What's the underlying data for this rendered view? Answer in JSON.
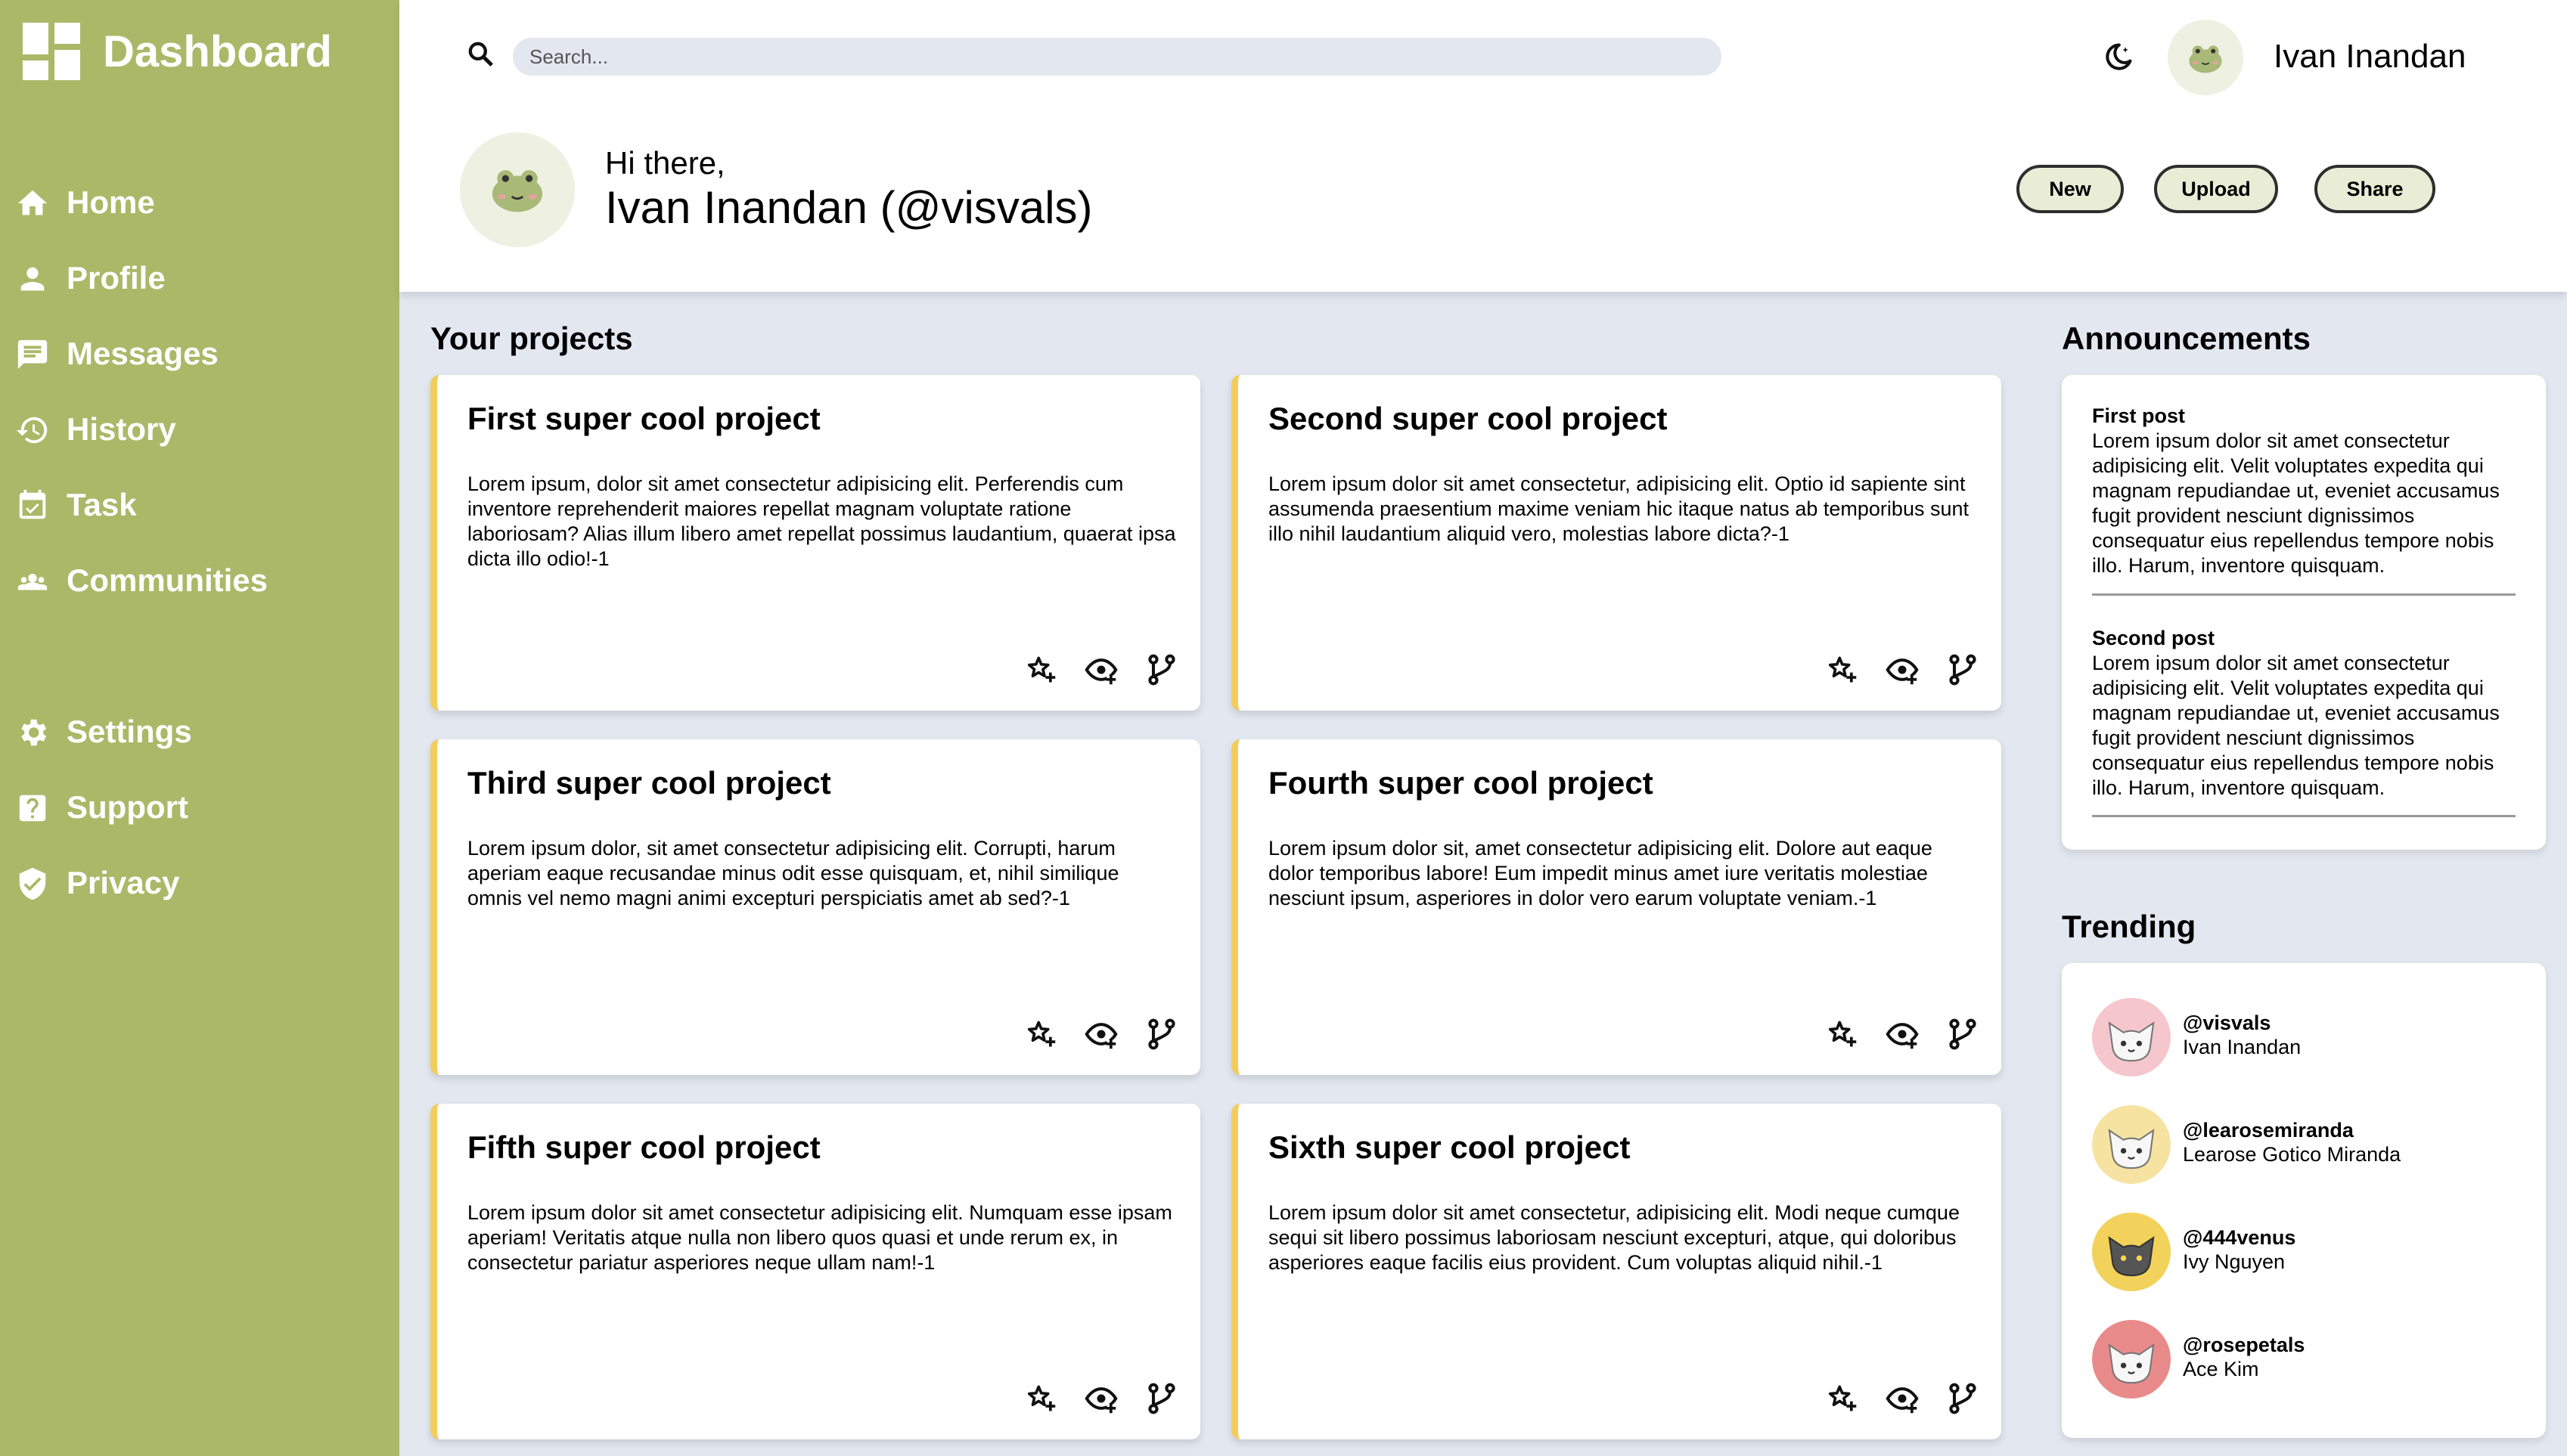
{
  "sidebar": {
    "brand": "Dashboard",
    "nav_top": [
      {
        "label": "Home",
        "icon": "home-icon"
      },
      {
        "label": "Profile",
        "icon": "person-icon"
      },
      {
        "label": "Messages",
        "icon": "chat-icon"
      },
      {
        "label": "History",
        "icon": "history-icon"
      },
      {
        "label": "Task",
        "icon": "calendar-check-icon"
      },
      {
        "label": "Communities",
        "icon": "group-icon"
      }
    ],
    "nav_bottom": [
      {
        "label": "Settings",
        "icon": "gear-icon"
      },
      {
        "label": "Support",
        "icon": "help-icon"
      },
      {
        "label": "Privacy",
        "icon": "shield-check-icon"
      }
    ]
  },
  "header": {
    "search_placeholder": "Search...",
    "user_name": "Ivan Inandan",
    "greeting": "Hi there,",
    "full_name": "Ivan Inandan (@visvals)",
    "buttons": {
      "new": "New",
      "upload": "Upload",
      "share": "Share"
    }
  },
  "projects": {
    "heading": "Your projects",
    "items": [
      {
        "title": "First super cool project",
        "desc": "Lorem ipsum, dolor sit amet consectetur adipisicing elit. Perferendis cum inventore reprehenderit maiores repellat magnam voluptate ratione laboriosam? Alias illum libero amet repellat possimus laudantium, quaerat ipsa dicta illo odio!-1"
      },
      {
        "title": "Second super cool project",
        "desc": "Lorem ipsum dolor sit amet consectetur, adipisicing elit. Optio id sapiente sint assumenda praesentium maxime veniam hic itaque natus ab temporibus sunt illo nihil laudantium aliquid vero, molestias labore dicta?-1"
      },
      {
        "title": "Third super cool project",
        "desc": "Lorem ipsum dolor, sit amet consectetur adipisicing elit. Corrupti, harum aperiam eaque recusandae minus odit esse quisquam, et, nihil similique omnis vel nemo magni animi excepturi perspiciatis amet ab sed?-1"
      },
      {
        "title": "Fourth super cool project",
        "desc": "Lorem ipsum dolor sit, amet consectetur adipisicing elit. Dolore aut eaque dolor temporibus labore! Eum impedit minus amet iure veritatis molestiae nesciunt ipsum, asperiores in dolor vero earum voluptate veniam.-1"
      },
      {
        "title": "Fifth super cool project",
        "desc": "Lorem ipsum dolor sit amet consectetur adipisicing elit. Numquam esse ipsam aperiam! Veritatis atque nulla non libero quos quasi et unde rerum ex, in consectetur pariatur asperiores neque ullam nam!-1"
      },
      {
        "title": "Sixth super cool project",
        "desc": "Lorem ipsum dolor sit amet consectetur, adipisicing elit. Modi neque cumque sequi sit libero possimus laboriosam nesciunt excepturi, atque, qui doloribus asperiores eaque facilis eius provident. Cum voluptas aliquid nihil.-1"
      }
    ]
  },
  "announcements": {
    "heading": "Announcements",
    "posts": [
      {
        "title": "First post",
        "body": "Lorem ipsum dolor sit amet consectetur adipisicing elit. Velit voluptates expedita qui magnam repudiandae ut, eveniet accusamus fugit provident nesciunt dignissimos consequatur eius repellendus tempore nobis illo. Harum, inventore quisquam."
      },
      {
        "title": "Second post",
        "body": "Lorem ipsum dolor sit amet consectetur adipisicing elit. Velit voluptates expedita qui magnam repudiandae ut, eveniet accusamus fugit provident nesciunt dignissimos consequatur eius repellendus tempore nobis illo. Harum, inventore quisquam."
      }
    ]
  },
  "trending": {
    "heading": "Trending",
    "users": [
      {
        "handle": "@visvals",
        "name": "Ivan Inandan",
        "color": "#f5c6cb"
      },
      {
        "handle": "@learosemiranda",
        "name": "Learose Gotico Miranda",
        "color": "#f6e3a1"
      },
      {
        "handle": "@444venus",
        "name": "Ivy Nguyen",
        "color": "#f2d25a"
      },
      {
        "handle": "@rosepetals",
        "name": "Ace Kim",
        "color": "#e98a8a"
      }
    ]
  },
  "colors": {
    "sidebar": "#abb868",
    "card_accent": "#f2cd5c",
    "background": "#e2e7f0"
  }
}
